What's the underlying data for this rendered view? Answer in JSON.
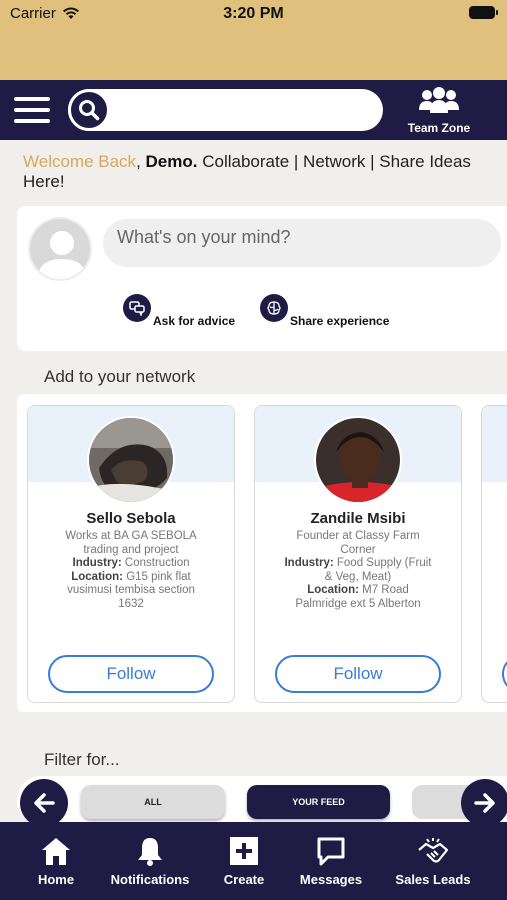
{
  "status_bar": {
    "carrier": "Carrier",
    "time": "3:20 PM"
  },
  "nav": {
    "search_placeholder": "",
    "team_zone_label": "Team Zone"
  },
  "welcome": {
    "greeting": "Welcome Back",
    "comma": ",",
    "name": "Demo.",
    "tagline": "Collaborate | Network | Share Ideas Here!"
  },
  "composer": {
    "placeholder": "What's on your mind?",
    "actions": [
      {
        "label": "Ask for advice",
        "icon": "chat-bubbles-icon"
      },
      {
        "label": "Share experience",
        "icon": "brain-icon"
      }
    ]
  },
  "network": {
    "title": "Add to your network",
    "people": [
      {
        "name": "Sello Sebola",
        "works_at": "Works at BA GA SEBOLA trading and project",
        "industry_label": "Industry:",
        "industry": "Construction",
        "location_label": "Location:",
        "location": "G15 pink flat vusimusi tembisa section 1632",
        "follow_label": "Follow"
      },
      {
        "name": "Zandile Msibi",
        "works_at": "Founder at Classy Farm Corner",
        "industry_label": "Industry:",
        "industry": "Food Supply (Fruit & Veg, Meat)",
        "location_label": "Location:",
        "location": "M7 Road Palmridge ext 5 Alberton",
        "follow_label": "Follow"
      }
    ]
  },
  "filter": {
    "title": "Filter for...",
    "chips": [
      "ALL",
      "YOUR FEED",
      ""
    ]
  },
  "tabbar": {
    "items": [
      {
        "label": "Home",
        "icon": "home-icon"
      },
      {
        "label": "Notifications",
        "icon": "bell-icon"
      },
      {
        "label": "Create",
        "icon": "plus-icon"
      },
      {
        "label": "Messages",
        "icon": "message-icon"
      },
      {
        "label": "Sales Leads",
        "icon": "handshake-icon"
      }
    ]
  },
  "colors": {
    "navy": "#1e1c44",
    "gold": "#dfc07c",
    "welcome_gold": "#d6a85b",
    "follow_blue": "#3a7bd5"
  }
}
